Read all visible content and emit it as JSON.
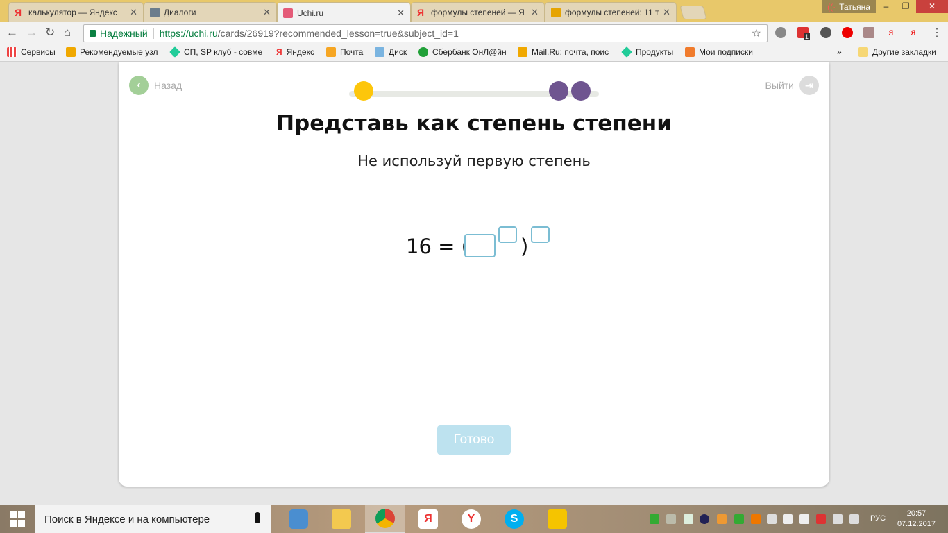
{
  "browser": {
    "tabs": [
      {
        "label": "калькулятор — Яндекс",
        "icon": "yandex-icon",
        "active": false
      },
      {
        "label": "Диалоги",
        "icon": "chat-icon",
        "active": false
      },
      {
        "label": "Uchi.ru",
        "icon": "uchi-icon",
        "active": true
      },
      {
        "label": "формулы степеней — Я",
        "icon": "yandex-icon",
        "active": false
      },
      {
        "label": "формулы степеней: 11 т",
        "icon": "image-icon",
        "active": false
      }
    ],
    "close_glyph": "✕",
    "user": "Татьяна",
    "secure_label": "Надежный",
    "url_host": "https://uchi.ru",
    "url_path": "/cards/26919?recommended_lesson=true&subject_id=1",
    "extension_badge": "1",
    "bookmarks": [
      {
        "label": "Сервисы",
        "icon": "apps-icon"
      },
      {
        "label": "Рекомендуемые узл",
        "icon": "bing-icon"
      },
      {
        "label": "СП, SP клуб - совме",
        "icon": "gem-icon"
      },
      {
        "label": "Яндекс",
        "icon": "yandex-icon"
      },
      {
        "label": "Почта",
        "icon": "mail-icon"
      },
      {
        "label": "Диск",
        "icon": "disk-icon"
      },
      {
        "label": "Сбербанк ОнЛ@йн",
        "icon": "sberbank-icon"
      },
      {
        "label": "Mail.Ru: почта, поис",
        "icon": "mailru-icon"
      },
      {
        "label": "Продукты",
        "icon": "gem-icon"
      },
      {
        "label": "Мои подписки",
        "icon": "subscriptions-icon"
      }
    ],
    "more_bookmarks": "»",
    "other_bookmarks": "Другие закладки"
  },
  "lesson": {
    "back_label": "Назад",
    "exit_label": "Выйти",
    "progress": {
      "current_color": "#fdc60b",
      "remaining_color": "#6f5590",
      "steps_total": 3,
      "current_step": 1
    },
    "title": "Представь как степень степени",
    "subtitle": "Не используй первую степень",
    "equation_lhs": "16 = (",
    "equation_close": ")",
    "inputs": {
      "base": "",
      "inner_exponent": "",
      "outer_exponent": ""
    },
    "done_label": "Готово"
  },
  "taskbar": {
    "search_placeholder": "Поиск в Яндексе и на компьютере",
    "lang": "РУС",
    "time": "20:57",
    "date": "07.12.2017"
  }
}
